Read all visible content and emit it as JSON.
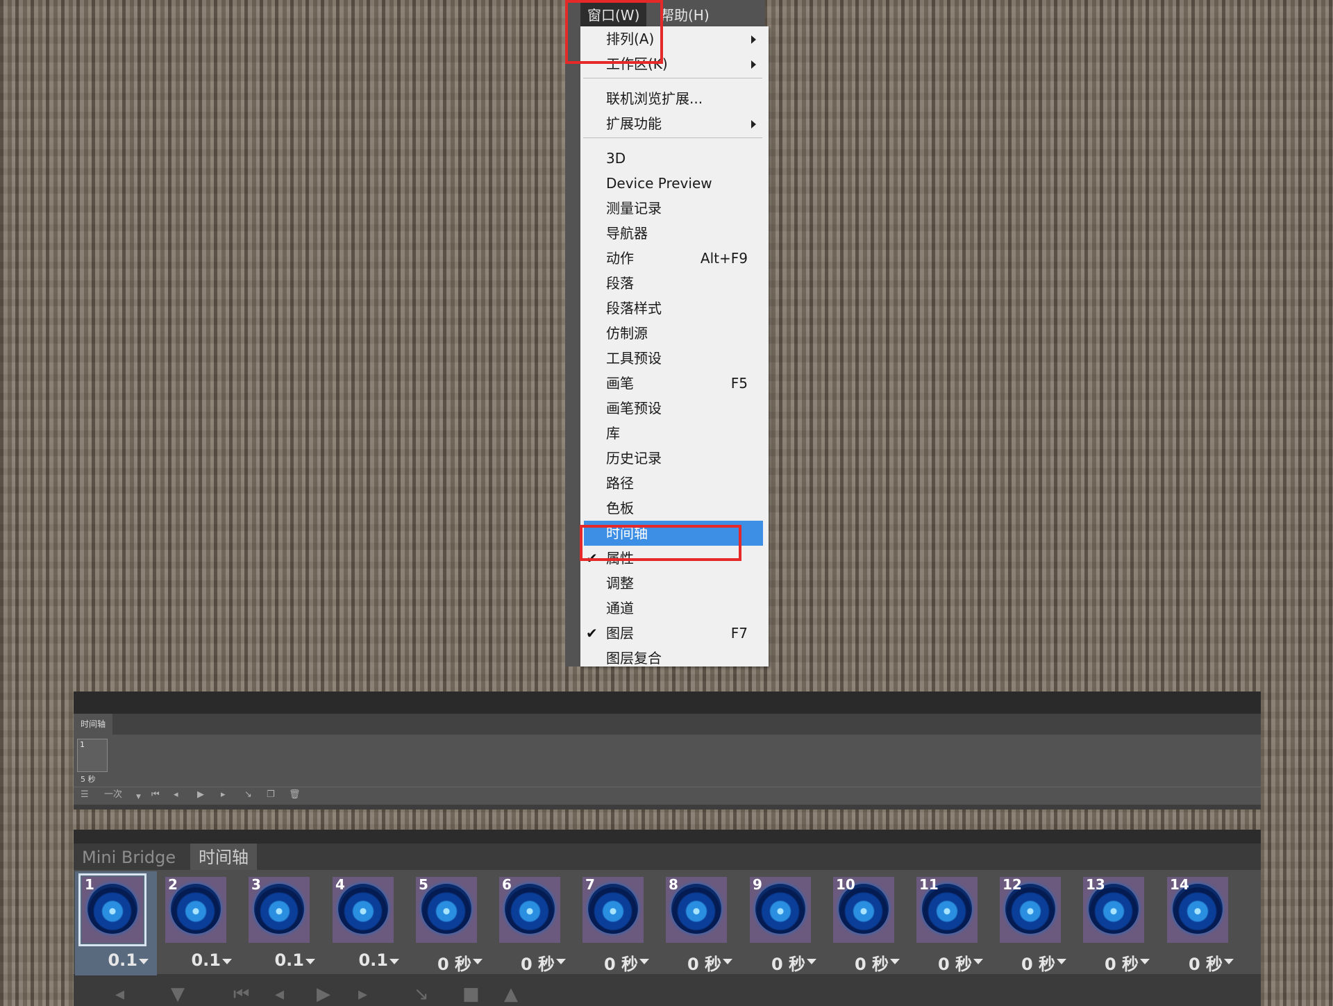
{
  "menubar": {
    "window_label": "窗口(W)",
    "help_label": "帮助(H)"
  },
  "window_menu": {
    "items": [
      {
        "label": "排列(A)",
        "submenu": true
      },
      {
        "label": "工作区(K)",
        "submenu": true
      },
      {
        "label": "联机浏览扩展..."
      },
      {
        "label": "扩展功能",
        "submenu": true
      },
      {
        "label": "3D"
      },
      {
        "label": "Device Preview"
      },
      {
        "label": "测量记录"
      },
      {
        "label": "导航器"
      },
      {
        "label": "动作",
        "shortcut": "Alt+F9"
      },
      {
        "label": "段落"
      },
      {
        "label": "段落样式"
      },
      {
        "label": "仿制源"
      },
      {
        "label": "工具预设"
      },
      {
        "label": "画笔",
        "shortcut": "F5"
      },
      {
        "label": "画笔预设"
      },
      {
        "label": "库"
      },
      {
        "label": "历史记录"
      },
      {
        "label": "路径"
      },
      {
        "label": "色板"
      },
      {
        "label": "时间轴",
        "highlighted": true
      },
      {
        "label": "属性",
        "checked": true
      },
      {
        "label": "调整"
      },
      {
        "label": "通道"
      },
      {
        "label": "图层",
        "shortcut": "F7",
        "checked": true
      },
      {
        "label": "图层复合"
      }
    ],
    "check_glyph": "✔"
  },
  "timeline_small": {
    "tab_label": "时间轴",
    "frame_number": "1",
    "frame_duration": "5 秒",
    "loop_option": "一次"
  },
  "timeline_large": {
    "tabs": [
      {
        "label": "Mini Bridge",
        "active": false
      },
      {
        "label": "时间轴",
        "active": true
      }
    ],
    "frames": [
      {
        "number": "1",
        "duration": "0.1",
        "selected": true
      },
      {
        "number": "2",
        "duration": "0.1"
      },
      {
        "number": "3",
        "duration": "0.1"
      },
      {
        "number": "4",
        "duration": "0.1"
      },
      {
        "number": "5",
        "duration": "0 秒"
      },
      {
        "number": "6",
        "duration": "0 秒"
      },
      {
        "number": "7",
        "duration": "0 秒"
      },
      {
        "number": "8",
        "duration": "0 秒"
      },
      {
        "number": "9",
        "duration": "0 秒"
      },
      {
        "number": "10",
        "duration": "0 秒"
      },
      {
        "number": "11",
        "duration": "0 秒"
      },
      {
        "number": "12",
        "duration": "0 秒"
      },
      {
        "number": "13",
        "duration": "0 秒"
      },
      {
        "number": "14",
        "duration": "0 秒"
      }
    ]
  },
  "colors": {
    "highlight": "#3c8fe4",
    "annotation_red": "#e52828",
    "thumbnail_bg": "#6b5a7e"
  }
}
